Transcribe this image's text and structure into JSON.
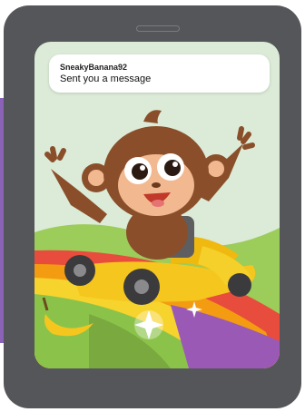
{
  "notification": {
    "username": "SneakyBanana92",
    "message": "Sent you a message"
  },
  "scene": {
    "character_icon": "monkey-driving-banana-car-icon",
    "decoration_icon": "banana-icon",
    "sparkle_icon": "sparkle-icon"
  },
  "colors": {
    "device": "#555659",
    "background_panel": "#8a63b6",
    "screen_sky": "#dcebd8",
    "rainbow": [
      "#e84c3d",
      "#f39c12",
      "#f6d32d",
      "#8bc34a",
      "#9b59b6"
    ]
  }
}
